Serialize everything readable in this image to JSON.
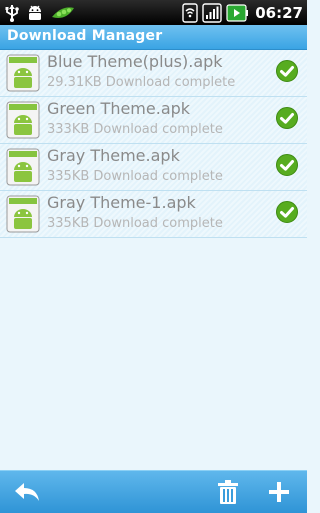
{
  "status_bar": {
    "time": "06:27",
    "left_icons": [
      "usb-icon",
      "android-debug-icon",
      "pea-pod-icon"
    ],
    "right_icons": [
      "wifi-icon",
      "signal-icon",
      "battery-icon"
    ]
  },
  "app": {
    "title": "Download Manager",
    "accent_color": "#3aa4e4"
  },
  "downloads": [
    {
      "name": "Blue Theme(plus).apk",
      "status": "29.31KB Download complete",
      "icon": "android-apk-icon",
      "state_icon": "check-icon"
    },
    {
      "name": "Green Theme.apk",
      "status": "333KB Download complete",
      "icon": "android-apk-icon",
      "state_icon": "check-icon"
    },
    {
      "name": "Gray Theme.apk",
      "status": "335KB Download complete",
      "icon": "android-apk-icon",
      "state_icon": "check-icon"
    },
    {
      "name": "Gray Theme-1.apk",
      "status": "335KB Download complete",
      "icon": "android-apk-icon",
      "state_icon": "check-icon"
    }
  ],
  "bottom_bar": {
    "buttons": [
      "back-arrow-icon",
      "trash-icon",
      "plus-icon"
    ]
  }
}
